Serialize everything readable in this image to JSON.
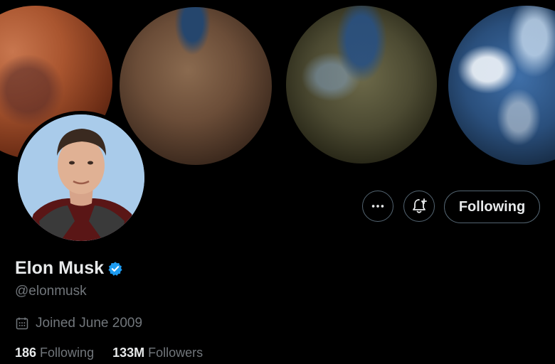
{
  "profile": {
    "display_name": "Elon Musk",
    "handle": "@elonmusk",
    "joined": "Joined June 2009",
    "verified": true
  },
  "stats": {
    "following_count": "186",
    "following_label": "Following",
    "followers_count": "133M",
    "followers_label": "Followers"
  },
  "actions": {
    "more_icon": "more-horizontal-icon",
    "notify_icon": "bell-plus-icon",
    "following_label": "Following"
  },
  "colors": {
    "background": "#000000",
    "primary_text": "#e7e9ea",
    "secondary_text": "#71767b",
    "border": "#536471",
    "verified_blue": "#1d9bf0"
  }
}
